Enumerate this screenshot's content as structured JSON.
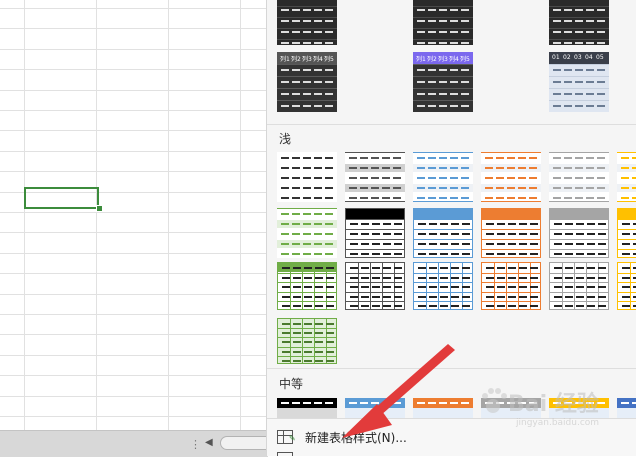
{
  "panel": {
    "section_light": "浅",
    "section_medium": "中等",
    "menu_new_style": "新建表格样式(N)...",
    "dark_header_cols": [
      "列1",
      "列2",
      "列3",
      "列4",
      "列5"
    ],
    "number_header_cols": [
      "01",
      "02",
      "03",
      "04",
      "05"
    ]
  },
  "colors": {
    "sheet_grid": "#e1e1e1",
    "active_cell": "#3c8c3c",
    "arrow": "#e23b3b",
    "panel_bg": "#f5f5f5",
    "light_styles": [
      "#333333",
      "#555555",
      "#5b9bd5",
      "#ed7d31",
      "#a5a5a5",
      "#ffc000"
    ],
    "medium_styles": [
      "#000000",
      "#5b9bd5",
      "#ed7d31",
      "#a5a5a5",
      "#ffc000",
      "#4472c4"
    ],
    "green": "#70ad47",
    "purple": "#7b68ee"
  },
  "watermark": {
    "text": "Bai 经验",
    "sub": "jingyan.baidu.com"
  }
}
